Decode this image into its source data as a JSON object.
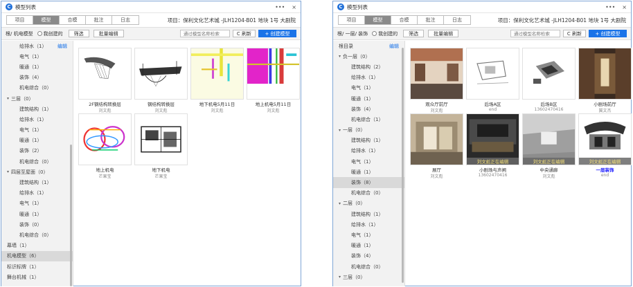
{
  "colors": {
    "accent": "#1a73e8",
    "active_tab": "#8a8a8a",
    "window_border": "#7fa6d6",
    "editing_text": "#f6e27a"
  },
  "left": {
    "window": {
      "title": "模型列表",
      "more": "•••",
      "close": "×"
    },
    "tabs": [
      {
        "label": "项目",
        "active": false
      },
      {
        "label": "模型",
        "active": true
      },
      {
        "label": "合模",
        "active": false
      },
      {
        "label": "批注",
        "active": false
      },
      {
        "label": "日志",
        "active": false
      }
    ],
    "project_label": "项目：保利文化艺术城 -JLH1204-B01 地块 1号 大剧院",
    "toolbar": {
      "breadcrumb": "根/ 机电模型",
      "mine_label": "我创建的",
      "filter_label": "筛选",
      "batch_label": "批量编辑",
      "search_placeholder": "通过模型名称检索",
      "refresh_label": "C 刷新",
      "create_label": "+ 创建模型"
    },
    "sidebar": {
      "edit_link": "编辑",
      "rows": [
        {
          "label": "给排水（1）",
          "level": 1,
          "caret": "",
          "selected": false
        },
        {
          "label": "电气（1）",
          "level": 1,
          "caret": "",
          "selected": false
        },
        {
          "label": "暖通（1）",
          "level": 1,
          "caret": "",
          "selected": false
        },
        {
          "label": "装饰（4）",
          "level": 1,
          "caret": "",
          "selected": false
        },
        {
          "label": "机电综合（0）",
          "level": 1,
          "caret": "",
          "selected": false
        },
        {
          "label": "三层（0）",
          "level": 0,
          "caret": "▾",
          "selected": false
        },
        {
          "label": "建筑结构（1）",
          "level": 1,
          "caret": "",
          "selected": false
        },
        {
          "label": "给排水（1）",
          "level": 1,
          "caret": "",
          "selected": false
        },
        {
          "label": "电气（1）",
          "level": 1,
          "caret": "",
          "selected": false
        },
        {
          "label": "暖通（1）",
          "level": 1,
          "caret": "",
          "selected": false
        },
        {
          "label": "装饰（2）",
          "level": 1,
          "caret": "",
          "selected": false
        },
        {
          "label": "机电综合（0）",
          "level": 1,
          "caret": "",
          "selected": false
        },
        {
          "label": "四层至屋面（0）",
          "level": 0,
          "caret": "▾",
          "selected": false
        },
        {
          "label": "建筑结构（1）",
          "level": 1,
          "caret": "",
          "selected": false
        },
        {
          "label": "给排水（1）",
          "level": 1,
          "caret": "",
          "selected": false
        },
        {
          "label": "电气（1）",
          "level": 1,
          "caret": "",
          "selected": false
        },
        {
          "label": "暖通（1）",
          "level": 1,
          "caret": "",
          "selected": false
        },
        {
          "label": "装饰（0）",
          "level": 1,
          "caret": "",
          "selected": false
        },
        {
          "label": "机电综合（0）",
          "level": 1,
          "caret": "",
          "selected": false
        },
        {
          "label": "幕墙（1）",
          "level": 0,
          "caret": "",
          "selected": false
        },
        {
          "label": "机电模型（6）",
          "level": 0,
          "caret": "",
          "selected": true
        },
        {
          "label": "标识标牌（1）",
          "level": 0,
          "caret": "",
          "selected": false
        },
        {
          "label": "舞台机械（1）",
          "level": 0,
          "caret": "",
          "selected": false
        }
      ]
    },
    "cards": [
      {
        "name": "2F钢结构转换层",
        "author": "刘文彪",
        "thumb": "steel-ribbon",
        "editing": false,
        "highlight": false
      },
      {
        "name": "钢结构转换层",
        "author": "刘文彪",
        "thumb": "steel-frame",
        "editing": false,
        "highlight": false
      },
      {
        "name": "地下机电5月11日",
        "author": "刘文彪",
        "thumb": "mep-yellow",
        "editing": false,
        "highlight": false
      },
      {
        "name": "地上机电5月11日",
        "author": "刘文彪",
        "thumb": "mep-magenta",
        "editing": false,
        "highlight": false
      },
      {
        "name": "地上机电",
        "author": "芒果宝",
        "thumb": "mep-colorful",
        "editing": false,
        "highlight": false
      },
      {
        "name": "地下机电",
        "author": "芒果宝",
        "thumb": "mep-dark",
        "editing": false,
        "highlight": false
      }
    ]
  },
  "right": {
    "window": {
      "title": "模型列表",
      "more": "•••",
      "close": "×"
    },
    "tabs": [
      {
        "label": "项目",
        "active": false
      },
      {
        "label": "模型",
        "active": true
      },
      {
        "label": "合模",
        "active": false
      },
      {
        "label": "批注",
        "active": false
      },
      {
        "label": "日志",
        "active": false
      }
    ],
    "project_label": "项目：保利文化艺术城 -JLH1204-B01 地块 1号 大剧院",
    "toolbar": {
      "breadcrumb": "根/ 一层/ 装饰",
      "mine_label": "我创建的",
      "filter_label": "筛选",
      "batch_label": "批量编辑",
      "search_placeholder": "通过模型名称检索",
      "refresh_label": "C 刷新",
      "create_label": "+ 创建模型"
    },
    "sidebar": {
      "edit_link": "编辑",
      "rows": [
        {
          "label": "根目录",
          "level": 0,
          "caret": "",
          "selected": false
        },
        {
          "label": "负一层（0）",
          "level": 0,
          "caret": "▾",
          "selected": false
        },
        {
          "label": "建筑结构（2）",
          "level": 1,
          "caret": "",
          "selected": false
        },
        {
          "label": "给排水（1）",
          "level": 1,
          "caret": "",
          "selected": false
        },
        {
          "label": "电气（1）",
          "level": 1,
          "caret": "",
          "selected": false
        },
        {
          "label": "暖通（1）",
          "level": 1,
          "caret": "",
          "selected": false
        },
        {
          "label": "装饰（4）",
          "level": 1,
          "caret": "",
          "selected": false
        },
        {
          "label": "机电综合（1）",
          "level": 1,
          "caret": "",
          "selected": false
        },
        {
          "label": "一层（0）",
          "level": 0,
          "caret": "▾",
          "selected": false
        },
        {
          "label": "建筑结构（1）",
          "level": 1,
          "caret": "",
          "selected": false
        },
        {
          "label": "给排水（1）",
          "level": 1,
          "caret": "",
          "selected": false
        },
        {
          "label": "电气（1）",
          "level": 1,
          "caret": "",
          "selected": false
        },
        {
          "label": "暖通（1）",
          "level": 1,
          "caret": "",
          "selected": false
        },
        {
          "label": "装饰（8）",
          "level": 1,
          "caret": "",
          "selected": true
        },
        {
          "label": "机电综合（0）",
          "level": 1,
          "caret": "",
          "selected": false
        },
        {
          "label": "二层（0）",
          "level": 0,
          "caret": "▾",
          "selected": false
        },
        {
          "label": "建筑结构（1）",
          "level": 1,
          "caret": "",
          "selected": false
        },
        {
          "label": "给排水（1）",
          "level": 1,
          "caret": "",
          "selected": false
        },
        {
          "label": "电气（1）",
          "level": 1,
          "caret": "",
          "selected": false
        },
        {
          "label": "暖通（1）",
          "level": 1,
          "caret": "",
          "selected": false
        },
        {
          "label": "装饰（4）",
          "level": 1,
          "caret": "",
          "selected": false
        },
        {
          "label": "机电综合（0）",
          "level": 1,
          "caret": "",
          "selected": false
        },
        {
          "label": "三层（0）",
          "level": 0,
          "caret": "▾",
          "selected": false
        }
      ]
    },
    "cards": [
      {
        "name": "观众厅前厅",
        "author": "刘文彪",
        "thumb": "lobby",
        "editing": false,
        "highlight": false
      },
      {
        "name": "后场A区",
        "author": "end",
        "thumb": "backA",
        "editing": false,
        "highlight": false
      },
      {
        "name": "后场B区",
        "author": "13602470416",
        "thumb": "backB",
        "editing": false,
        "highlight": false
      },
      {
        "name": "小剧场前厅",
        "author": "冀文杰",
        "thumb": "corridor",
        "editing": false,
        "highlight": false
      },
      {
        "name": "展厅",
        "author": "刘文彪",
        "thumb": "hall",
        "editing": false,
        "highlight": false
      },
      {
        "name": "小剧场与声闸",
        "author": "13602470416",
        "thumb": "small-theater",
        "editing": true,
        "highlight": false
      },
      {
        "name": "中央通廊",
        "author": "刘文彪",
        "thumb": "central",
        "editing": true,
        "highlight": false
      },
      {
        "name": "一层装饰",
        "author": "end",
        "thumb": "floor1",
        "editing": true,
        "highlight": true
      }
    ],
    "editing_banner": "刘文彪正在编辑"
  }
}
